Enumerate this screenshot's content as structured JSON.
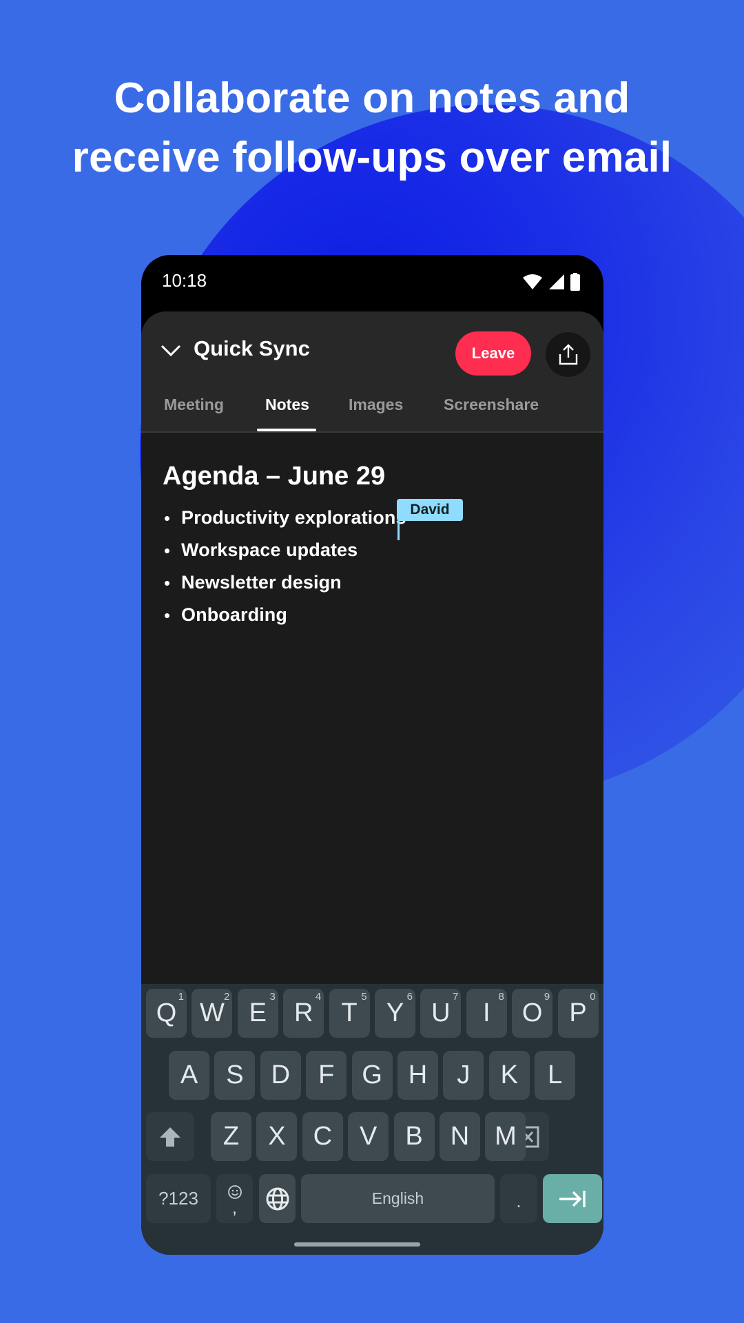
{
  "headline": {
    "line1": "Collaborate on notes and",
    "line2": "receive follow-ups over email"
  },
  "status_bar": {
    "time": "10:18",
    "icons": [
      "wifi-icon",
      "cellular-signal-icon",
      "battery-icon"
    ]
  },
  "app_header": {
    "collapse_icon": "chevron-down-icon",
    "title": "Quick Sync",
    "leave_label": "Leave",
    "share_icon": "share-upload-icon",
    "colors": {
      "leave": "#ff2d4f"
    }
  },
  "tabs": [
    {
      "label": "Meeting",
      "active": false
    },
    {
      "label": "Notes",
      "active": true
    },
    {
      "label": "Images",
      "active": false
    },
    {
      "label": "Screenshare",
      "active": false
    }
  ],
  "notes": {
    "title": "Agenda – June 29",
    "bullets": [
      "Productivity explorations",
      "Workspace updates",
      "Newsletter design",
      "Onboarding"
    ],
    "collaborator_cursor": {
      "name": "David",
      "color": "#8fdcff"
    }
  },
  "keyboard": {
    "row1": [
      {
        "key": "Q",
        "hint": "1"
      },
      {
        "key": "W",
        "hint": "2"
      },
      {
        "key": "E",
        "hint": "3"
      },
      {
        "key": "R",
        "hint": "4"
      },
      {
        "key": "T",
        "hint": "5"
      },
      {
        "key": "Y",
        "hint": "6"
      },
      {
        "key": "U",
        "hint": "7"
      },
      {
        "key": "I",
        "hint": "8"
      },
      {
        "key": "O",
        "hint": "9"
      },
      {
        "key": "P",
        "hint": "0"
      }
    ],
    "row2": [
      "A",
      "S",
      "D",
      "F",
      "G",
      "H",
      "J",
      "K",
      "L"
    ],
    "row3": [
      "Z",
      "X",
      "C",
      "V",
      "B",
      "N",
      "M"
    ],
    "symbols_label": "?123",
    "comma_label": ",",
    "period_label": ".",
    "space_label": "English",
    "enter_color": "#69aea7"
  }
}
